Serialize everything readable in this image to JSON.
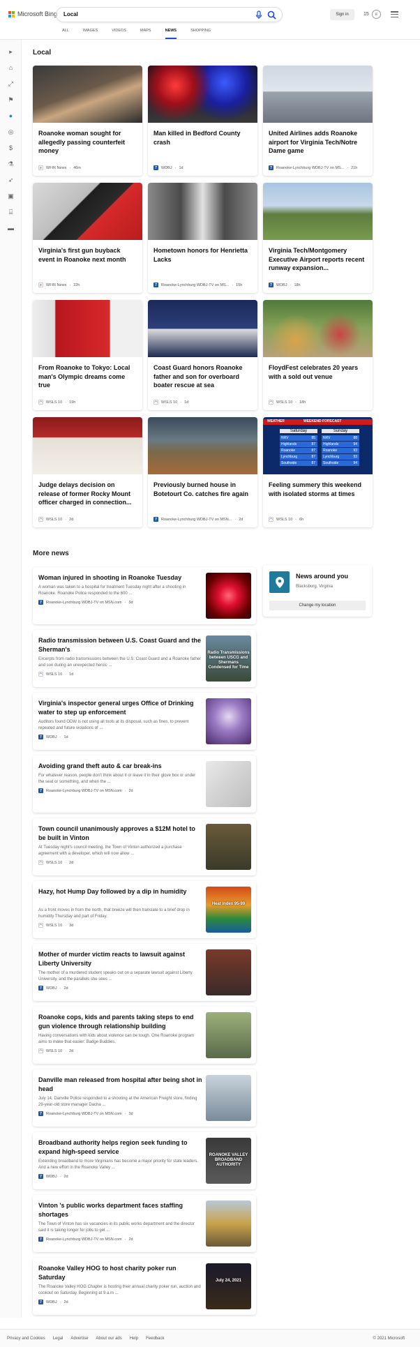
{
  "header": {
    "brand": "Microsoft Bing",
    "search_value": "Local",
    "signin_label": "Sign in",
    "rewards_count": "15",
    "tabs": [
      {
        "label": "ALL",
        "active": false
      },
      {
        "label": "IMAGES",
        "active": false
      },
      {
        "label": "VIDEOS",
        "active": false
      },
      {
        "label": "MAPS",
        "active": false
      },
      {
        "label": "NEWS",
        "active": true
      },
      {
        "label": "SHOPPING",
        "active": false
      }
    ]
  },
  "rail_icons": [
    "expand-icon",
    "home-icon",
    "trending-icon",
    "flag-icon",
    "location-icon",
    "globe-icon",
    "money-icon",
    "science-icon",
    "rocket-icon",
    "entertainment-icon",
    "politics-icon",
    "sports-icon"
  ],
  "local": {
    "heading": "Local",
    "cards": [
      {
        "title": "Roanoke woman sought for allegedly passing counterfeit money",
        "source": "WFIR News",
        "age": "46m",
        "src": "wfir"
      },
      {
        "title": "Man killed in Bedford County crash",
        "source": "WDBJ",
        "age": "1d",
        "src": "wdbj"
      },
      {
        "title": "United Airlines adds Roanoke airport for Virginia Tech/Notre Dame game",
        "source": "Roanoke-Lynchburg WDBJ-TV on MS...",
        "age": "21h",
        "src": "wdbj"
      },
      {
        "title": "Virginia's first gun buyback event in Roanoke next month",
        "source": "WFIR News",
        "age": "22h",
        "src": "wfir"
      },
      {
        "title": "Hometown honors for Henrietta Lacks",
        "source": "Roanoke-Lynchburg WDBJ-TV on MS...",
        "age": "15h",
        "src": "wdbj"
      },
      {
        "title": "Virginia Tech/Montgomery Executive Airport reports recent runway expansion...",
        "source": "WDBJ",
        "age": "18h",
        "src": "wdbj"
      },
      {
        "title": "From Roanoke to Tokyo: Local man's Olympic dreams come true",
        "source": "WSLS 10",
        "age": "19h",
        "src": "wsls"
      },
      {
        "title": "Coast Guard honors Roanoke father and son for overboard boater rescue at sea",
        "source": "WSLS 10",
        "age": "1d",
        "src": "wsls"
      },
      {
        "title": "FloydFest celebrates 20 years with a sold out venue",
        "source": "WSLS 10",
        "age": "18h",
        "src": "wsls"
      },
      {
        "title": "Judge delays decision on release of former Rocky Mount officer charged in connection...",
        "source": "WSLS 10",
        "age": "2d",
        "src": "wsls"
      },
      {
        "title": "Previously burned house in Botetourt Co. catches fire again",
        "source": "Roanoke-Lynchburg WDBJ-TV on MSN...",
        "age": "2d",
        "src": "wdbj"
      },
      {
        "title": "Feeling summery this weekend with isolated storms at times",
        "source": "WSLS 10",
        "age": "6h",
        "src": "wsls"
      }
    ]
  },
  "more_news": {
    "heading": "More news",
    "items": [
      {
        "title": "Woman injured in shooting in Roanoke Tuesday",
        "snippet": "A woman was taken to a hospital for treatment Tuesday night after a shooting in Roanoke. Roanoke Police responded to the 600 ...",
        "source": "Roanoke-Lynchburg WDBJ-TV on MSN.com",
        "age": "3d",
        "src": "wdbj"
      },
      {
        "title": "Radio transmission between U.S. Coast Guard and the Sherman's",
        "snippet": "Excerpts from radio transmissions between the U.S. Coast Guard and a Roanoke father and son during an unexpected heroic ...",
        "source": "WSLS 10",
        "age": "1d",
        "src": "wsls",
        "thumb_text": "Radio Transmissions between USCG and Shermans Condensed for Time"
      },
      {
        "title": "Virginia's inspector general urges Office of Drinking water to step up enforcement",
        "snippet": "Auditors found ODW is not using all tools at its disposal, such as fines, to prevent repeated and future violations of ...",
        "source": "WDBJ",
        "age": "1d",
        "src": "wdbj"
      },
      {
        "title": "Avoiding grand theft auto & car break-ins",
        "snippet": "For whatever reason, people don't think about it or leave it in their glove box or under the seat or something, and when the ...",
        "source": "Roanoke-Lynchburg WDBJ-TV on MSN.com",
        "age": "2d",
        "src": "wdbj"
      },
      {
        "title": "Town council unanimously approves a $12M hotel to be built in Vinton",
        "snippet": "At Tuesday night's council meeting, the Town of Vinton authorized a purchase agreement with a developer, which will now allow ...",
        "source": "WSLS 10",
        "age": "2d",
        "src": "wsls"
      },
      {
        "title": "Hazy, hot Hump Day followed by a dip in humidity",
        "snippet": "As a front moves in from the north, that breeze will then translate to a brief drop in humidity Thursday and part of Friday.",
        "source": "WSLS 10",
        "age": "3d",
        "src": "wsls",
        "thumb_text": "Heat Index 95-99"
      },
      {
        "title": "Mother of murder victim reacts to lawsuit against Liberty University",
        "snippet": "The mother of a murdered student speaks out on a separate lawsuit against Liberty University, and the parallels she sees ...",
        "source": "WDBJ",
        "age": "2d",
        "src": "wdbj"
      },
      {
        "title": "Roanoke cops, kids and parents taking steps to end gun violence through relationship building",
        "snippet": "Having conversations with kids about violence can be tough. One Roanoke program aims to make that easier: Badge Buddies.",
        "source": "WSLS 10",
        "age": "2d",
        "src": "wsls"
      },
      {
        "title": "Danville man released from hospital after being shot in head",
        "snippet": "July 14, Danville Police responded to a shooting at the American Freight store, finding 29-year-old store manager Dacha ...",
        "source": "Roanoke-Lynchburg WDBJ-TV on MSN.com",
        "age": "3d",
        "src": "wdbj"
      },
      {
        "title": "Broadband authority helps region seek funding to expand high-speed service",
        "snippet": "Extending broadband to more Virginians has become a major priority for state leaders. And a new effort in the Roanoke Valley ...",
        "source": "WDBJ",
        "age": "2d",
        "src": "wdbj",
        "thumb_text": "ROANOKE VALLEY BROADBAND AUTHORITY"
      },
      {
        "title": "Vinton 's public works department faces staffing shortages",
        "snippet": "The Town of Vinton has six vacancies in its public works department and the director said it is taking longer for jobs to get ...",
        "source": "Roanoke-Lynchburg WDBJ-TV on MSN.com",
        "age": "2d",
        "src": "wdbj"
      },
      {
        "title": "Roanoke Valley HOG to host charity poker run Saturday",
        "snippet": "The Roanoke Valley HOG Chapter is hosting their annual charity poker run, auction and cookout on Saturday. Beginning at 9 a.m ...",
        "source": "WDBJ",
        "age": "2d",
        "src": "wdbj",
        "thumb_text": "July 24, 2021"
      }
    ]
  },
  "aside": {
    "title": "News around you",
    "location": "Blacksburg, Virginia",
    "button": "Change my location"
  },
  "weather_card": {
    "banner_left": "WEATHER",
    "banner_right": "WEEKEND FORECAST",
    "day1": "Saturday",
    "day2": "Sunday",
    "rows": [
      [
        "NRV",
        "85",
        "NRV",
        "88"
      ],
      [
        "Highlands",
        "87",
        "Highlands",
        "94"
      ],
      [
        "Roanoke",
        "87",
        "Roanoke",
        "93"
      ],
      [
        "Lynchburg",
        "87",
        "Lynchburg",
        "93"
      ],
      [
        "Southside",
        "87",
        "Southside",
        "94"
      ]
    ]
  },
  "footer": {
    "links": [
      "Privacy and Cookies",
      "Legal",
      "Advertise",
      "About our ads",
      "Help",
      "Feedback"
    ],
    "copyright": "© 2021 Microsoft"
  },
  "colors": {
    "accent": "#174ae4",
    "location": "#1f7a9c",
    "wdbj": "#1b5aa8"
  }
}
